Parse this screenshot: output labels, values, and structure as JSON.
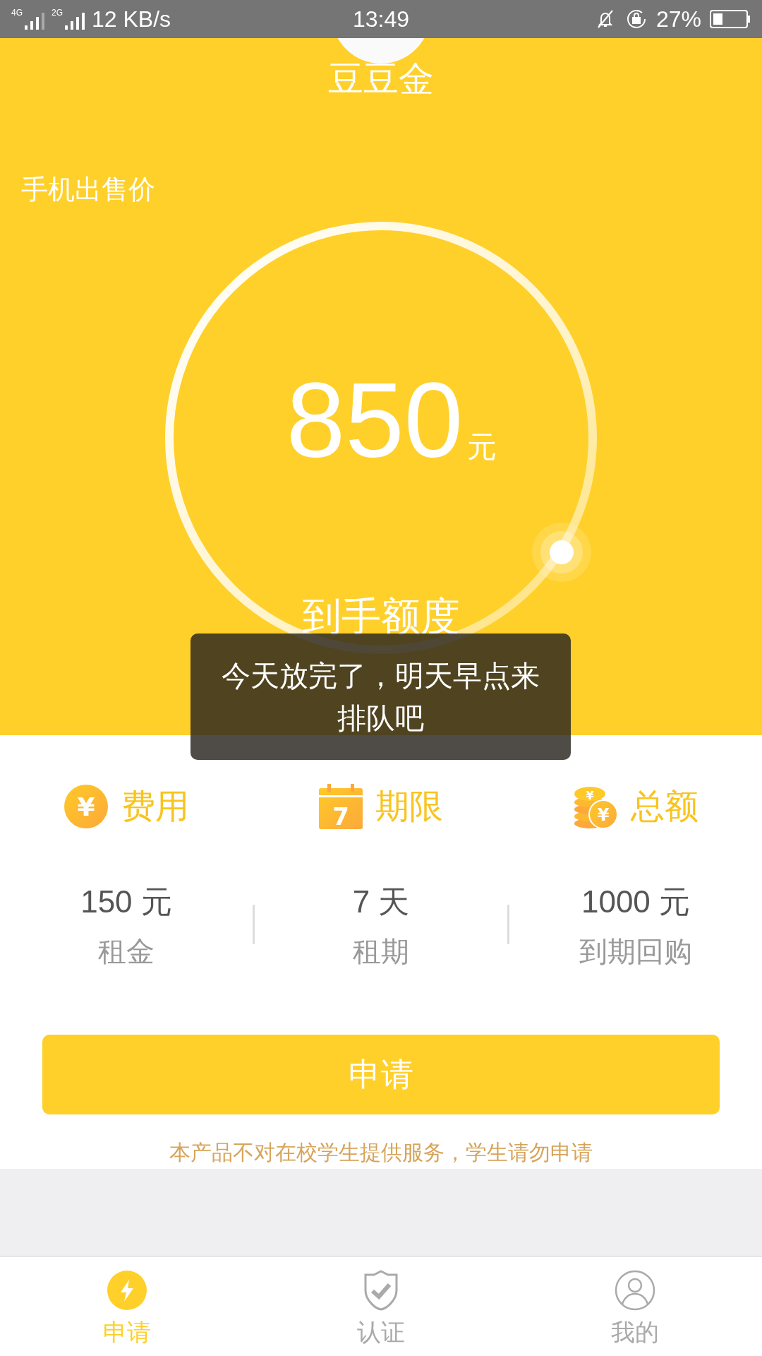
{
  "status_bar": {
    "network_1": "4G",
    "network_2": "2G",
    "speed": "12 KB/s",
    "time": "13:49",
    "battery": "27%"
  },
  "header": {
    "title": "豆豆金",
    "subtitle": "手机出售价",
    "amount": "850",
    "unit": "元",
    "caption": "到手额度"
  },
  "toast": {
    "text": "今天放完了，明天早点来排队吧"
  },
  "stats": [
    {
      "icon": {
        "kind": "coin",
        "glyphs": [
          "¥"
        ]
      },
      "title": "费用",
      "value": "150 元",
      "label": "租金"
    },
    {
      "icon": {
        "kind": "calendar",
        "glyphs": [
          "7"
        ]
      },
      "title": "期限",
      "value": "7 天",
      "label": "租期"
    },
    {
      "icon": {
        "kind": "coin-stack",
        "glyphs": [
          "¥",
          "¥"
        ]
      },
      "title": "总额",
      "value": "1000 元",
      "label": "到期回购"
    }
  ],
  "apply_button": {
    "label": "申请"
  },
  "notice": "本产品不对在校学生提供服务，学生请勿申请",
  "nav": [
    {
      "kind": "bolt",
      "label": "申请",
      "selected": true
    },
    {
      "kind": "shield",
      "label": "认证",
      "selected": false
    },
    {
      "kind": "person",
      "label": "我的",
      "selected": false
    }
  ]
}
